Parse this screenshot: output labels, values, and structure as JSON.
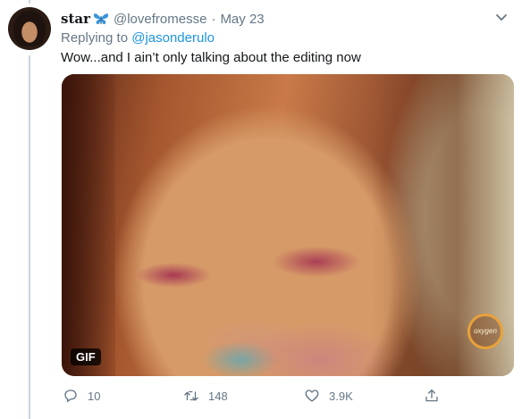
{
  "tweet": {
    "display_name": "star",
    "name_emoji_icon": "butterfly-icon",
    "handle": "@lovefromesse",
    "separator": "·",
    "date": "May 23",
    "replying_prefix": "Replying to",
    "replying_mention": "@jasonderulo",
    "text": "Wow...and I ain’t only talking about the editing now"
  },
  "media": {
    "badge": "GIF",
    "watermark": "oxygen"
  },
  "actions": {
    "reply_count": "10",
    "retweet_count": "148",
    "like_count": "3.9K"
  },
  "colors": {
    "accent": "#1b95e0",
    "muted": "#657786",
    "text": "#14171a",
    "butterfly": "#3b94d9"
  }
}
